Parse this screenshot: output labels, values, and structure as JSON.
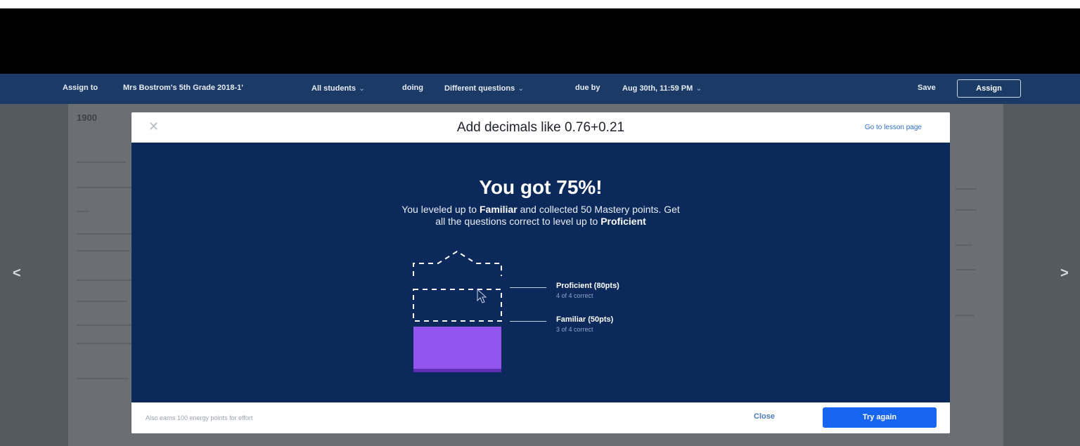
{
  "assign_bar": {
    "assign_to_label": "Assign to",
    "class_name": "Mrs Bostrom's 5th Grade 2018-1'",
    "students": "All students",
    "doing_label": "doing",
    "questions": "Different questions",
    "due_label": "due by",
    "due_date": "Aug 30th, 11:59 PM",
    "save_label": "Save",
    "assign_label": "Assign"
  },
  "background": {
    "title_fragment": "1900"
  },
  "nav": {
    "prev_icon": "chevron-left-icon",
    "next_icon": "chevron-right-icon"
  },
  "modal": {
    "title": "Add decimals like 0.76+0.21",
    "lesson_link": "Go to lesson page",
    "close_icon": "close-icon",
    "headline": "You got 75%!",
    "message_parts": {
      "p1": "You leveled up to ",
      "level_reached": "Familiar",
      "p2": " and collected 50 Mastery points. Get all the questions correct to level up to ",
      "next_level": "Proficient"
    },
    "levels": [
      {
        "name": "Proficient (80pts)",
        "requirement": "4 of 4 correct"
      },
      {
        "name": "Familiar (50pts)",
        "requirement": "3 of 4 correct"
      }
    ],
    "footer_note": "Also earns 100 energy points for effort",
    "close_label": "Close",
    "try_again_label": "Try again",
    "colors": {
      "body_bg": "#0b2a5b",
      "familiar_fill": "#9155ee",
      "primary_button": "#1865f2",
      "assign_bar_bg": "#1b3a66"
    }
  }
}
